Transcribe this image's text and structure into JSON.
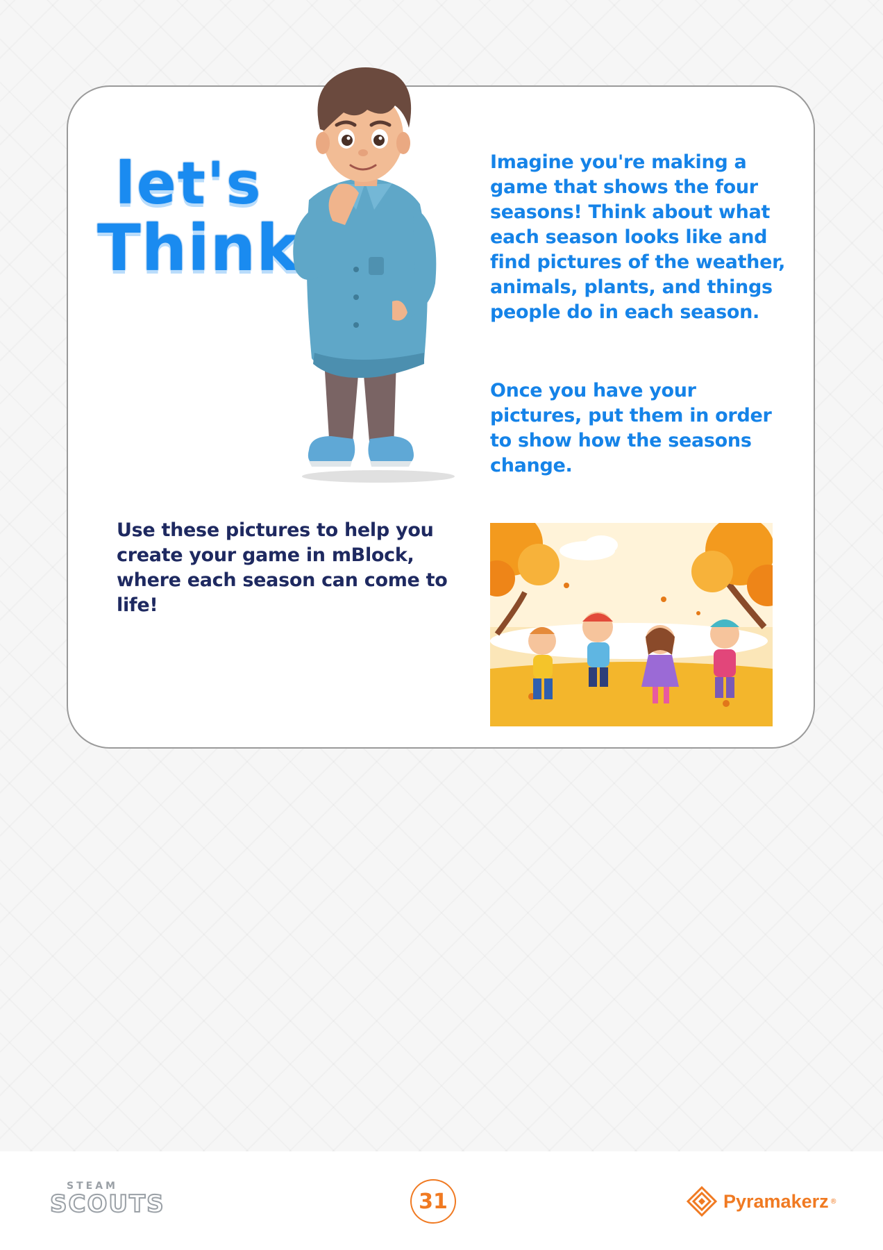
{
  "card": {
    "title_line1": "let's",
    "title_line2": "Think",
    "paragraph1": "Imagine you're making a game that shows the four seasons! Think about what each season looks like and find pictures of the weather, animals, plants, and things people do in each season.",
    "paragraph2": "Once you have your pictures, put them in order to show how the seasons change.",
    "paragraph3": "Use these pictures to help you create your game in mBlock, where each season can come to life!"
  },
  "footer": {
    "logo_left_top": "STEAM",
    "logo_left_main": "SCOUTS",
    "page_number": "31",
    "brand_name": "Pyramakerz",
    "brand_mark": "®"
  },
  "colors": {
    "title_blue": "#1a8bf0",
    "text_blue": "#1583e8",
    "text_navy": "#1e2960",
    "accent_orange": "#f07a22"
  },
  "icons": [
    "boy-character-illustration",
    "autumn-kids-illustration",
    "steam-scouts-logo",
    "pyramakerz-logo-icon"
  ]
}
